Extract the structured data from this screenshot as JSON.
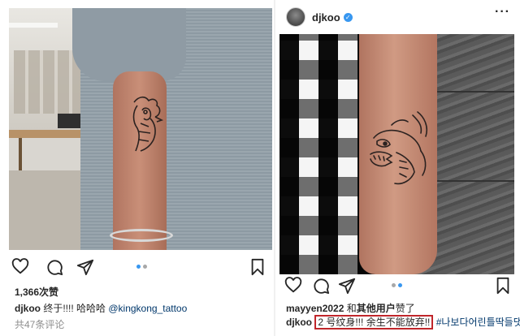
{
  "left_post": {
    "likes": "1,366次赞",
    "username": "djkoo",
    "caption": " 终于!!!! 哈哈哈 ",
    "mention": "@kingkong_tattoo",
    "comments": "共47条评论"
  },
  "right_post": {
    "header_username": "djkoo",
    "liked_by_user": "mayyen2022",
    "liked_by_and": " 和",
    "liked_by_others": "其他用户",
    "liked_by_suffix": "赞了",
    "username": "djkoo",
    "caption_highlight": "2 号纹身!!! 余生不能放弃!!",
    "hashtag": "#나보다어린틀딱들댓글사절"
  },
  "colors": {
    "accent": "#3897f0",
    "highlight_box": "#c0262b",
    "tag": "#00376b"
  },
  "icons": [
    "heart-icon",
    "comment-icon",
    "share-icon",
    "bookmark-icon",
    "verified-badge-icon",
    "more-icon"
  ]
}
